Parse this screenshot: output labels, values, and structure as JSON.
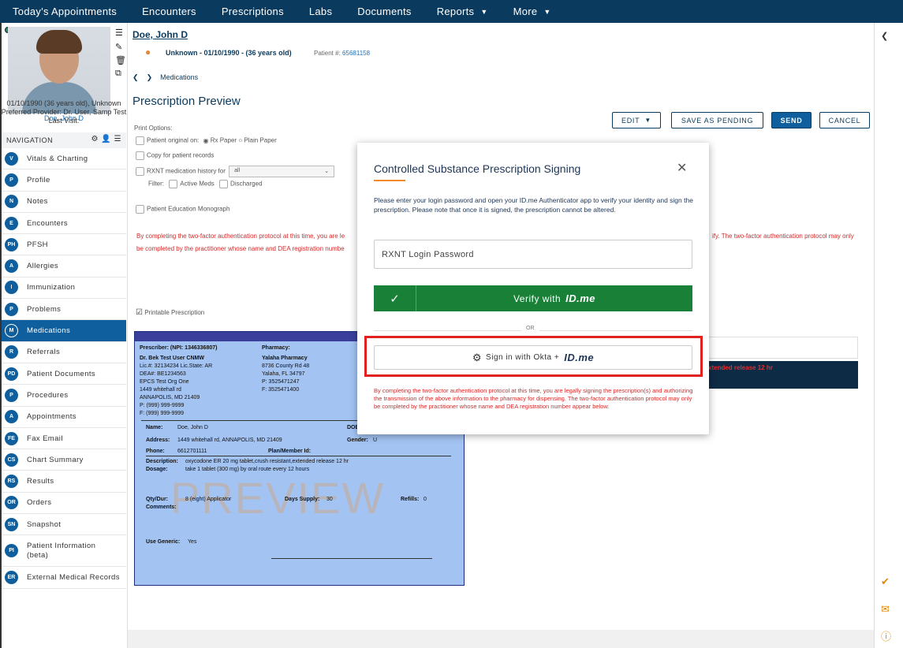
{
  "topnav": {
    "items": [
      {
        "label": "Today's Appointments"
      },
      {
        "label": "Encounters"
      },
      {
        "label": "Prescriptions"
      },
      {
        "label": "Labs"
      },
      {
        "label": "Documents"
      },
      {
        "label": "Reports"
      },
      {
        "label": "More"
      }
    ]
  },
  "patient": {
    "name_short": "Doe, John D",
    "dob_line": "01/10/1990 (36 years old), Unknown",
    "provider_line": "Preferred Provider: Dr. User, Samp Test",
    "last_visit": "Last Visit:",
    "header_name": "Doe, John D",
    "header_info": "Unknown - 01/10/1990 - (36 years old)",
    "patient_num_label": "Patient #:",
    "patient_num": "65681158"
  },
  "navigation": {
    "title": "NAVIGATION",
    "items": [
      {
        "abbr": "V",
        "label": "Vitals & Charting"
      },
      {
        "abbr": "P",
        "label": "Profile"
      },
      {
        "abbr": "N",
        "label": "Notes"
      },
      {
        "abbr": "E",
        "label": "Encounters"
      },
      {
        "abbr": "PH",
        "label": "PFSH"
      },
      {
        "abbr": "A",
        "label": "Allergies"
      },
      {
        "abbr": "I",
        "label": "Immunization"
      },
      {
        "abbr": "P",
        "label": "Problems"
      },
      {
        "abbr": "M",
        "label": "Medications"
      },
      {
        "abbr": "R",
        "label": "Referrals"
      },
      {
        "abbr": "PD",
        "label": "Patient Documents"
      },
      {
        "abbr": "P",
        "label": "Procedures"
      },
      {
        "abbr": "A",
        "label": "Appointments"
      },
      {
        "abbr": "FE",
        "label": "Fax Email"
      },
      {
        "abbr": "CS",
        "label": "Chart Summary"
      },
      {
        "abbr": "RS",
        "label": "Results"
      },
      {
        "abbr": "OR",
        "label": "Orders"
      },
      {
        "abbr": "SN",
        "label": "Snapshot"
      },
      {
        "abbr": "PI",
        "label": "Patient Information (beta)"
      },
      {
        "abbr": "ER",
        "label": "External Medical Records"
      }
    ]
  },
  "main": {
    "breadcrumb": "Medications",
    "page_title": "Prescription Preview",
    "buttons": {
      "edit": "EDIT",
      "save_pending": "SAVE AS PENDING",
      "send": "SEND",
      "cancel": "CANCEL"
    },
    "print_options": {
      "title": "Print Options:",
      "patient_original": "Patient original on:",
      "rx_paper": "Rx Paper",
      "plain_paper": "Plain Paper",
      "copy_patient": "Copy for patient records",
      "history": "RXNT medication history for",
      "history_select": "all",
      "filter": "Filter:",
      "active_meds": "Active Meds",
      "discharged": "Discharged",
      "monograph": "Patient Education Monograph",
      "printable": "Printable Prescription"
    },
    "warn_line1_left": "By completing the two-factor authentication protocol at this time, you are le",
    "warn_line2_left": "be completed by the practitioner whose name and DEA registration numbe",
    "warn_line1_right": "ify. The two-factor authentication protocol may only",
    "right_bar_text": "xtended release 12 hr"
  },
  "rx": {
    "prescriber_label": "Prescriber: (NPI: 1346336807)",
    "prescriber_lines": [
      "Dr. Bek Test User CNMW",
      "Lic.#: 32134234 Lic.State: AR",
      "DEA#: BE1234563",
      "EPCS Test Org One",
      "1449 whitehall rd",
      "ANNAPOLIS,  MD 21409",
      "P: (999) 999-9999",
      "F: (999) 999-9999"
    ],
    "pharmacy_label": "Pharmacy:",
    "pharmacy_lines": [
      "Yalaha Pharmacy",
      "8736 County Rd 48",
      "Yalaha,  FL 34797",
      "P: 3525471247",
      "F: 3525471400"
    ],
    "name_label": "Name:",
    "name_value": "Doe, John D",
    "dob_label": "DOB",
    "address_label": "Address:",
    "address_value": "1449 whitehall rd, ANNAPOLIS, MD 21409",
    "gender_label": "Gender:",
    "gender_value": "U",
    "phone_label": "Phone:",
    "phone_value": "6612701111",
    "plan_label": "Plan/Member Id:",
    "desc_label": "Description:",
    "desc_value": "oxycodone ER 20 mg tablet,crush resistant,extended release 12 hr",
    "dosage_label": "Dosage:",
    "dosage_value": "take 1 tablet (300 mg) by oral route every 12 hours",
    "qty_label": "Qty/Dur:",
    "qty_value": "8 (eight) Applicator",
    "supply_label": "Days Supply:",
    "supply_value": "30",
    "refills_label": "Refills:",
    "refills_value": "0",
    "comments_label": "Comments:",
    "generic_label": "Use Generic:",
    "generic_value": "Yes",
    "watermark": "PREVIEW"
  },
  "modal": {
    "title": "Controlled Substance Prescription Signing",
    "description": "Please enter your login password and open your ID.me Authenticator app to verify your identity and sign the prescription. Please note that once it is signed, the prescription cannot be altered.",
    "password_placeholder": "RXNT Login Password",
    "verify_label": "Verify with",
    "idme": "ID.me",
    "or": "OR",
    "okta_label": "Sign in with Okta +",
    "legal": "By completing the two-factor authentication protocol at this time, you are legally signing the prescription(s) and authorizing the transmission of the above information to the pharmacy for dispensing. The two-factor authentication protocol may only be completed by the practitioner whose name and DEA registration number appear below."
  },
  "colors": {
    "topnav": "#0a3a5e",
    "primary": "#0f5f9e",
    "verify_green": "#198038",
    "highlight_red": "#e0211f",
    "warning_text": "#d62828"
  }
}
